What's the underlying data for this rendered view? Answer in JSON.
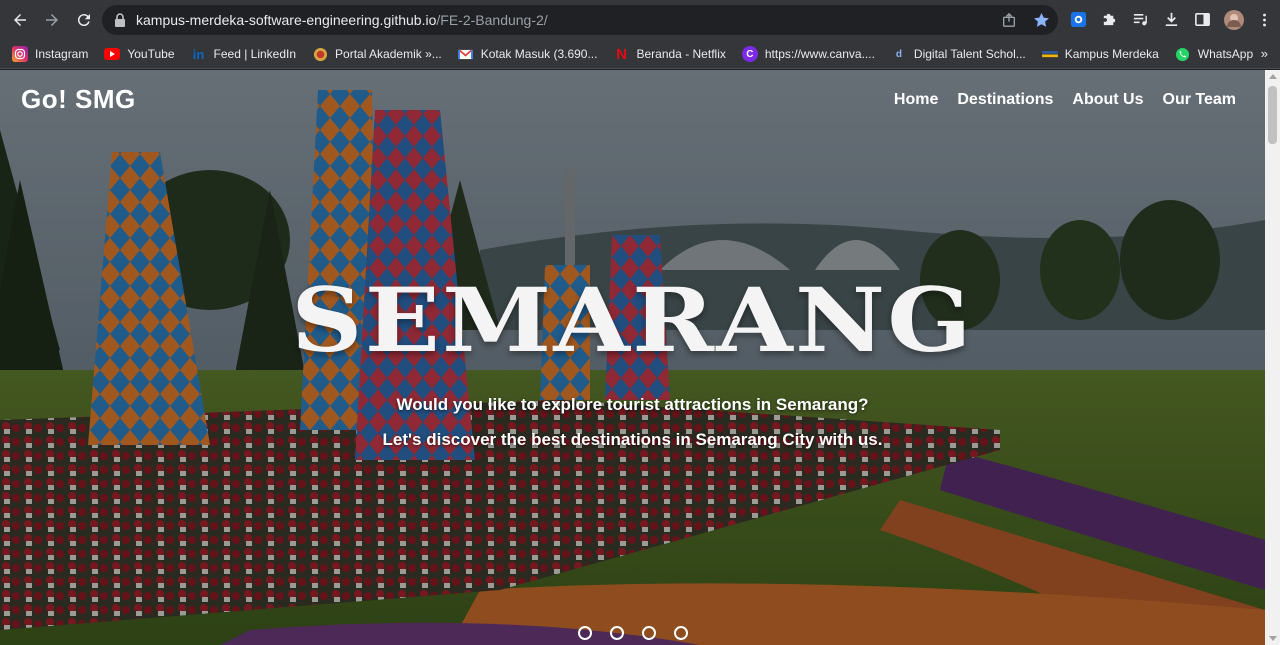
{
  "browser": {
    "url_host": "kampus-merdeka-software-engineering.github.io",
    "url_path": "/FE-2-Bandung-2/",
    "bookmarks": [
      {
        "label": "Instagram",
        "icon": "instagram-icon",
        "color": "#e1306c"
      },
      {
        "label": "YouTube",
        "icon": "youtube-icon",
        "color": "#ff0000"
      },
      {
        "label": "Feed | LinkedIn",
        "icon": "linkedin-icon",
        "color": "#0a66c2"
      },
      {
        "label": "Portal Akademik »...",
        "icon": "portal-icon",
        "color": "#c0392b"
      },
      {
        "label": "Kotak Masuk (3.690...",
        "icon": "gmail-icon",
        "color": "#ea4335"
      },
      {
        "label": "Beranda - Netflix",
        "icon": "netflix-icon",
        "color": "#e50914"
      },
      {
        "label": "https://www.canva....",
        "icon": "canva-icon",
        "color": "#7d2ae8"
      },
      {
        "label": "Digital Talent Schol...",
        "icon": "digitalent-icon",
        "color": "#1f4e9c"
      },
      {
        "label": "Kampus Merdeka",
        "icon": "kampus-merdeka-icon",
        "color": "#2c5aa0"
      },
      {
        "label": "WhatsApp",
        "icon": "whatsapp-icon",
        "color": "#25d366"
      }
    ],
    "more_label": "»"
  },
  "site": {
    "brand": "Go! SMG",
    "menu": [
      {
        "label": "Home"
      },
      {
        "label": "Destinations"
      },
      {
        "label": "About Us"
      },
      {
        "label": "Our Team"
      }
    ],
    "hero": {
      "title": "SEMARANG",
      "subtitle1": "Would you like to explore tourist attractions in Semarang?",
      "subtitle2": "Let's discover the best destinations in Semarang City with us."
    },
    "carousel_slides": 4
  }
}
